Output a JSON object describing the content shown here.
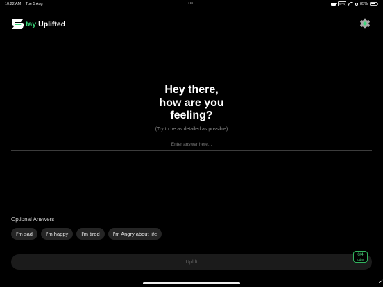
{
  "status": {
    "time": "10:22 AM",
    "date": "Tue 5 Aug",
    "dots": "•••",
    "vpn": "VPN",
    "battery": "85%",
    "battery_level": 0.85
  },
  "app": {
    "brand_accent": "tay",
    "brand_rest": " Uplifted",
    "accent_color": "#3ad67a"
  },
  "prompt": {
    "line1": "Hey there,",
    "line2": "how are you",
    "line3": "feeling?",
    "hint": "(Try to be as detailed as possible)",
    "input_value": "",
    "input_placeholder": "Enter answer here..."
  },
  "optional": {
    "label": "Optional Answers",
    "chips": [
      "I'm sad",
      "I'm happy",
      "I'm tired",
      "I'm Angry about life"
    ]
  },
  "action": {
    "uplift_label": "Uplift",
    "counter": "0/4",
    "counter_sub": "today"
  }
}
